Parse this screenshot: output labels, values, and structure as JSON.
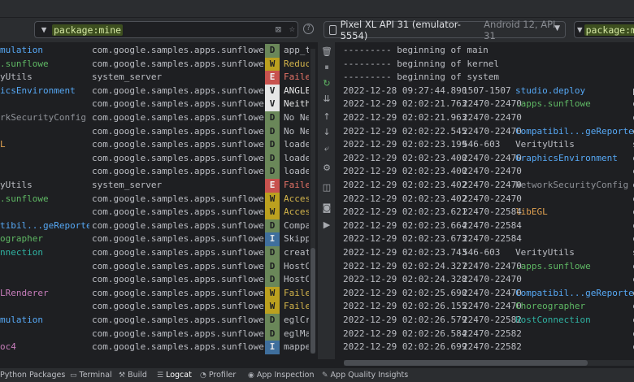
{
  "colors": {
    "accent": "#3574f0",
    "bg": "#1e1f22",
    "panel": "#2b2d30"
  },
  "filter": {
    "icon": "filter-icon",
    "value": "package:mine",
    "clear_icon": "close-icon",
    "star_icon": "star-icon"
  },
  "help_icon": "?",
  "device": {
    "name": "Pixel XL API 31 (emulator-5554)",
    "api": "Android 12, API 31"
  },
  "filter_right": {
    "value": "package:mine"
  },
  "left_rows": [
    {
      "tag": "mulation",
      "tag_color": "#56a8f5",
      "pkg": "com.google.samples.apps.sunflower",
      "lvl": "D",
      "msg": "app_t"
    },
    {
      "tag": ".sunflowe",
      "tag_color": "#5fb864",
      "pkg": "com.google.samples.apps.sunflower",
      "lvl": "W",
      "msg": "Reduc"
    },
    {
      "tag": "yUtils",
      "tag_color": "#bcbec4",
      "pkg": "system_server",
      "lvl": "E",
      "msg": "Faile"
    },
    {
      "tag": "icsEnvironment",
      "tag_color": "#56a8f5",
      "pkg": "com.google.samples.apps.sunflower",
      "lvl": "V",
      "msg": "ANGLE"
    },
    {
      "tag": "",
      "tag_color": "#bcbec4",
      "pkg": "com.google.samples.apps.sunflower",
      "lvl": "V",
      "msg": "Neith"
    },
    {
      "tag": "rkSecurityConfig",
      "tag_color": "#8f9298",
      "pkg": "com.google.samples.apps.sunflower",
      "lvl": "D",
      "msg": "No Ne"
    },
    {
      "tag": "",
      "tag_color": "#bcbec4",
      "pkg": "com.google.samples.apps.sunflower",
      "lvl": "D",
      "msg": "No Ne"
    },
    {
      "tag": "L",
      "tag_color": "#e0a050",
      "pkg": "com.google.samples.apps.sunflower",
      "lvl": "D",
      "msg": "loade"
    },
    {
      "tag": "",
      "tag_color": "#bcbec4",
      "pkg": "com.google.samples.apps.sunflower",
      "lvl": "D",
      "msg": "loade"
    },
    {
      "tag": "",
      "tag_color": "#bcbec4",
      "pkg": "com.google.samples.apps.sunflower",
      "lvl": "D",
      "msg": "loade"
    },
    {
      "tag": "yUtils",
      "tag_color": "#bcbec4",
      "pkg": "system_server",
      "lvl": "E",
      "msg": "Faile"
    },
    {
      "tag": ".sunflowe",
      "tag_color": "#5fb864",
      "pkg": "com.google.samples.apps.sunflower",
      "lvl": "W",
      "msg": "Acces"
    },
    {
      "tag": "",
      "tag_color": "#bcbec4",
      "pkg": "com.google.samples.apps.sunflower",
      "lvl": "W",
      "msg": "Acces"
    },
    {
      "tag": "tibil...geReporter",
      "tag_color": "#56a8f5",
      "pkg": "com.google.samples.apps.sunflower",
      "lvl": "D",
      "msg": "Compa"
    },
    {
      "tag": "ographer",
      "tag_color": "#5fb864",
      "pkg": "com.google.samples.apps.sunflower",
      "lvl": "I",
      "msg": "Skipp"
    },
    {
      "tag": "nnection",
      "tag_color": "#2fb3a3",
      "pkg": "com.google.samples.apps.sunflower",
      "lvl": "D",
      "msg": "creat"
    },
    {
      "tag": "",
      "tag_color": "#bcbec4",
      "pkg": "com.google.samples.apps.sunflower",
      "lvl": "D",
      "msg": "HostC"
    },
    {
      "tag": "",
      "tag_color": "#bcbec4",
      "pkg": "com.google.samples.apps.sunflower",
      "lvl": "D",
      "msg": "HostC"
    },
    {
      "tag": "LRenderer",
      "tag_color": "#c77dbb",
      "pkg": "com.google.samples.apps.sunflower",
      "lvl": "W",
      "msg": "Faile"
    },
    {
      "tag": "",
      "tag_color": "#bcbec4",
      "pkg": "com.google.samples.apps.sunflower",
      "lvl": "W",
      "msg": "Faile"
    },
    {
      "tag": "mulation",
      "tag_color": "#56a8f5",
      "pkg": "com.google.samples.apps.sunflower",
      "lvl": "D",
      "msg": "eglCr"
    },
    {
      "tag": "",
      "tag_color": "#bcbec4",
      "pkg": "com.google.samples.apps.sunflower",
      "lvl": "D",
      "msg": "eglMa"
    },
    {
      "tag": "oc4",
      "tag_color": "#c77dbb",
      "pkg": "com.google.samples.apps.sunflower",
      "lvl": "I",
      "msg": "mappe"
    }
  ],
  "toolbar_icons": [
    "trash-icon",
    "pause-icon",
    "restart-icon",
    "scroll-to-end-icon",
    "up-icon",
    "down-icon",
    "soft-wrap-icon",
    "settings-icon",
    "split-icon",
    "camera-icon",
    "video-icon"
  ],
  "right_rows": [
    {
      "ts": "--------- beginning of main",
      "pid": "",
      "tag": "",
      "tag_color": "#bcbec4",
      "tail": ""
    },
    {
      "ts": "--------- beginning of kernel",
      "pid": "",
      "tag": "",
      "tag_color": "#bcbec4",
      "tail": ""
    },
    {
      "ts": "--------- beginning of system",
      "pid": "",
      "tag": "",
      "tag_color": "#bcbec4",
      "tail": ""
    },
    {
      "ts": "2022-12-28 09:27:44.890",
      "pid": "1507-1507",
      "tag": "studio.deploy",
      "tag_color": "#56a8f5",
      "tail": "p"
    },
    {
      "ts": "2022-12-29 02:02:21.763",
      "pid": "22470-22470",
      "tag": ".apps.sunflowe",
      "tag_color": "#5fb864",
      "tail": "c"
    },
    {
      "ts": "2022-12-29 02:02:21.963",
      "pid": "22470-22470",
      "tag": "",
      "tag_color": "#bcbec4",
      "tail": "c"
    },
    {
      "ts": "2022-12-29 02:02:22.545",
      "pid": "22470-22470",
      "tag": "Compatibil...geReporter",
      "tag_color": "#56a8f5",
      "tail": "c"
    },
    {
      "ts": "2022-12-29 02:02:23.199",
      "pid": "546-603",
      "tag": "VerityUtils",
      "tag_color": "#bcbec4",
      "tail": "s"
    },
    {
      "ts": "2022-12-29 02:02:23.400",
      "pid": "22470-22470",
      "tag": "GraphicsEnvironment",
      "tag_color": "#56a8f5",
      "tail": "c"
    },
    {
      "ts": "2022-12-29 02:02:23.400",
      "pid": "22470-22470",
      "tag": "",
      "tag_color": "#bcbec4",
      "tail": "c"
    },
    {
      "ts": "2022-12-29 02:02:23.402",
      "pid": "22470-22470",
      "tag": "NetworkSecurityConfig",
      "tag_color": "#8f9298",
      "tail": "c"
    },
    {
      "ts": "2022-12-29 02:02:23.402",
      "pid": "22470-22470",
      "tag": "",
      "tag_color": "#bcbec4",
      "tail": "c"
    },
    {
      "ts": "2022-12-29 02:02:23.621",
      "pid": "22470-22584",
      "tag": "libEGL",
      "tag_color": "#e0a050",
      "tail": "c"
    },
    {
      "ts": "2022-12-29 02:02:23.664",
      "pid": "22470-22584",
      "tag": "",
      "tag_color": "#bcbec4",
      "tail": "c"
    },
    {
      "ts": "2022-12-29 02:02:23.673",
      "pid": "22470-22584",
      "tag": "",
      "tag_color": "#bcbec4",
      "tail": "c"
    },
    {
      "ts": "2022-12-29 02:02:23.743",
      "pid": "546-603",
      "tag": "VerityUtils",
      "tag_color": "#bcbec4",
      "tail": "s"
    },
    {
      "ts": "2022-12-29 02:02:24.327",
      "pid": "22470-22470",
      "tag": ".apps.sunflowe",
      "tag_color": "#5fb864",
      "tail": "c"
    },
    {
      "ts": "2022-12-29 02:02:24.328",
      "pid": "22470-22470",
      "tag": "",
      "tag_color": "#bcbec4",
      "tail": "c"
    },
    {
      "ts": "2022-12-29 02:02:25.690",
      "pid": "22470-22470",
      "tag": "Compatibil...geReporter",
      "tag_color": "#56a8f5",
      "tail": "c"
    },
    {
      "ts": "2022-12-29 02:02:26.155",
      "pid": "22470-22470",
      "tag": "Choreographer",
      "tag_color": "#5fb864",
      "tail": "c"
    },
    {
      "ts": "2022-12-29 02:02:26.579",
      "pid": "22470-22582",
      "tag": "HostConnection",
      "tag_color": "#2fb3a3",
      "tail": "c"
    },
    {
      "ts": "2022-12-29 02:02:26.584",
      "pid": "22470-22582",
      "tag": "",
      "tag_color": "#bcbec4",
      "tail": "c"
    },
    {
      "ts": "2022-12-29 02:02:26.699",
      "pid": "22470-22582",
      "tag": "",
      "tag_color": "#bcbec4",
      "tail": "c"
    }
  ],
  "bottom_tabs": [
    {
      "label": "Python Packages",
      "icon": "python-packages-icon",
      "glyph": "",
      "active": false
    },
    {
      "label": "Terminal",
      "icon": "terminal-icon",
      "glyph": "▭",
      "active": false
    },
    {
      "label": "Build",
      "icon": "hammer-icon",
      "glyph": "⚒",
      "active": false
    },
    {
      "label": "Logcat",
      "icon": "logcat-icon",
      "glyph": "☰",
      "active": true
    },
    {
      "label": "Profiler",
      "icon": "profiler-icon",
      "glyph": "◔",
      "active": false
    },
    {
      "label": "App Inspection",
      "icon": "app-inspection-icon",
      "glyph": "◉",
      "active": false
    },
    {
      "label": "App Quality Insights",
      "icon": "app-quality-insights-icon",
      "glyph": "✎",
      "active": false
    }
  ]
}
